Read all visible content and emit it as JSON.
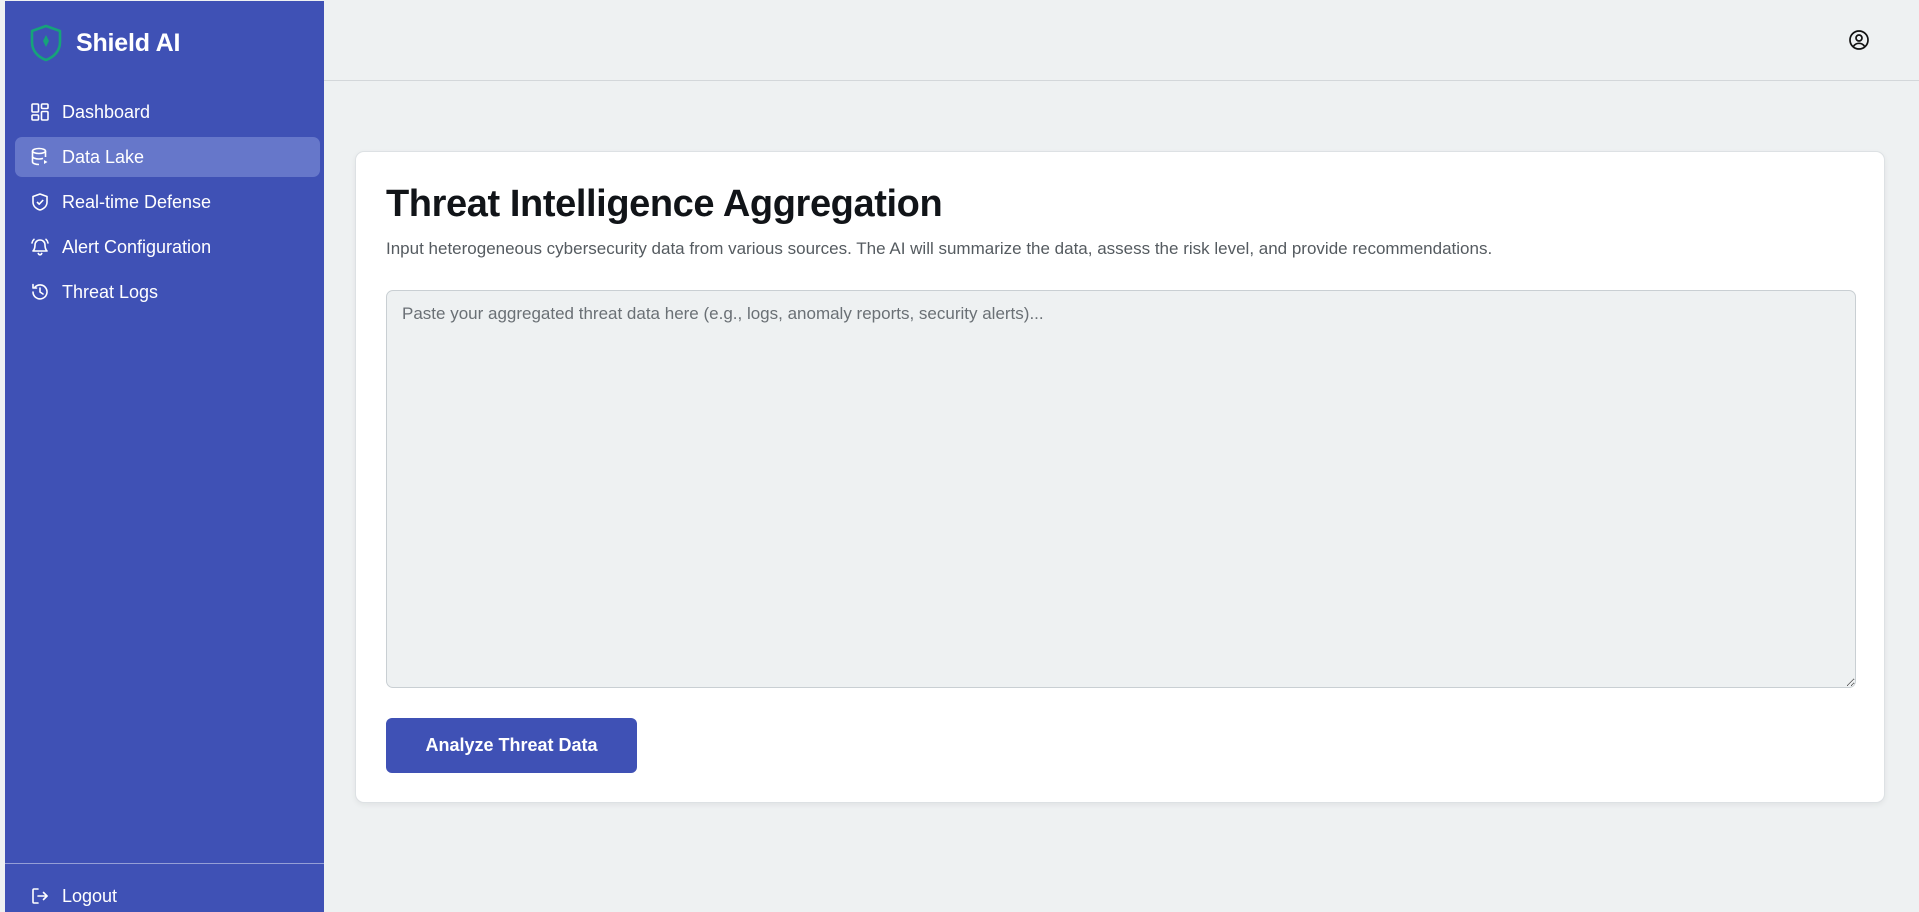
{
  "app": {
    "name": "Shield AI",
    "brand_color": "#3f51b5",
    "logo_icon": "shield-icon",
    "logo_color": "#16a37a"
  },
  "sidebar": {
    "items": [
      {
        "label": "Dashboard",
        "icon": "dashboard-grid-icon",
        "active": false
      },
      {
        "label": "Data Lake",
        "icon": "database-icon",
        "active": true
      },
      {
        "label": "Real-time Defense",
        "icon": "shield-check-icon",
        "active": false
      },
      {
        "label": "Alert Configuration",
        "icon": "bell-icon",
        "active": false
      },
      {
        "label": "Threat Logs",
        "icon": "history-icon",
        "active": false
      }
    ],
    "logout": {
      "label": "Logout",
      "icon": "logout-icon"
    }
  },
  "header": {
    "user_icon": "user-circle-icon"
  },
  "main": {
    "title": "Threat Intelligence Aggregation",
    "description": "Input heterogeneous cybersecurity data from various sources. The AI will summarize the data, assess the risk level, and provide recommendations.",
    "input": {
      "value": "",
      "placeholder": "Paste your aggregated threat data here (e.g., logs, anomaly reports, security alerts)..."
    },
    "analyze_button": "Analyze Threat Data"
  }
}
